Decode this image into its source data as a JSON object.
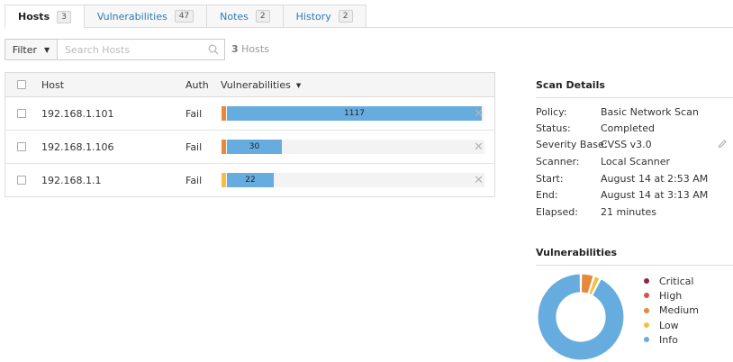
{
  "tabs": [
    {
      "label": "Hosts",
      "count": "3"
    },
    {
      "label": "Vulnerabilities",
      "count": "47"
    },
    {
      "label": "Notes",
      "count": "2"
    },
    {
      "label": "History",
      "count": "2"
    }
  ],
  "filter": {
    "label": "Filter",
    "search_placeholder": "Search Hosts",
    "count_number": "3",
    "count_text": "Hosts"
  },
  "table": {
    "headers": {
      "host": "Host",
      "auth": "Auth",
      "vulnerabilities": "Vulnerabilities"
    },
    "rows": [
      {
        "host": "192.168.1.101",
        "auth": "Fail",
        "info_count": "1117",
        "info_fraction": 0.99,
        "other_color": "#e8883a"
      },
      {
        "host": "192.168.1.106",
        "auth": "Fail",
        "info_count": "30",
        "info_fraction": 0.23,
        "other_color": "#e8883a"
      },
      {
        "host": "192.168.1.1",
        "auth": "Fail",
        "info_count": "22",
        "info_fraction": 0.2,
        "other_color": "#f3c142"
      }
    ]
  },
  "scan_details": {
    "title": "Scan Details",
    "policy_label": "Policy:",
    "policy": "Basic Network Scan",
    "status_label": "Status:",
    "status": "Completed",
    "severity_label": "Severity Base:",
    "severity": "CVSS v3.0",
    "scanner_label": "Scanner:",
    "scanner": "Local Scanner",
    "start_label": "Start:",
    "start": "August 14 at 2:53 AM",
    "end_label": "End:",
    "end": "August 14 at 3:13 AM",
    "elapsed_label": "Elapsed:",
    "elapsed": "21 minutes"
  },
  "vulnerabilities": {
    "title": "Vulnerabilities",
    "legend": [
      {
        "label": "Critical",
        "color": "#91243e"
      },
      {
        "label": "High",
        "color": "#dd4b50"
      },
      {
        "label": "Medium",
        "color": "#e8883a"
      },
      {
        "label": "Low",
        "color": "#f3c142"
      },
      {
        "label": "Info",
        "color": "#67acdf"
      }
    ],
    "donut_fractions": {
      "critical": 0,
      "high": 0,
      "medium": 0.05,
      "low": 0.025,
      "info": 0.925
    }
  },
  "colors": {
    "info": "#67acdf",
    "link": "#2a7ab8"
  }
}
